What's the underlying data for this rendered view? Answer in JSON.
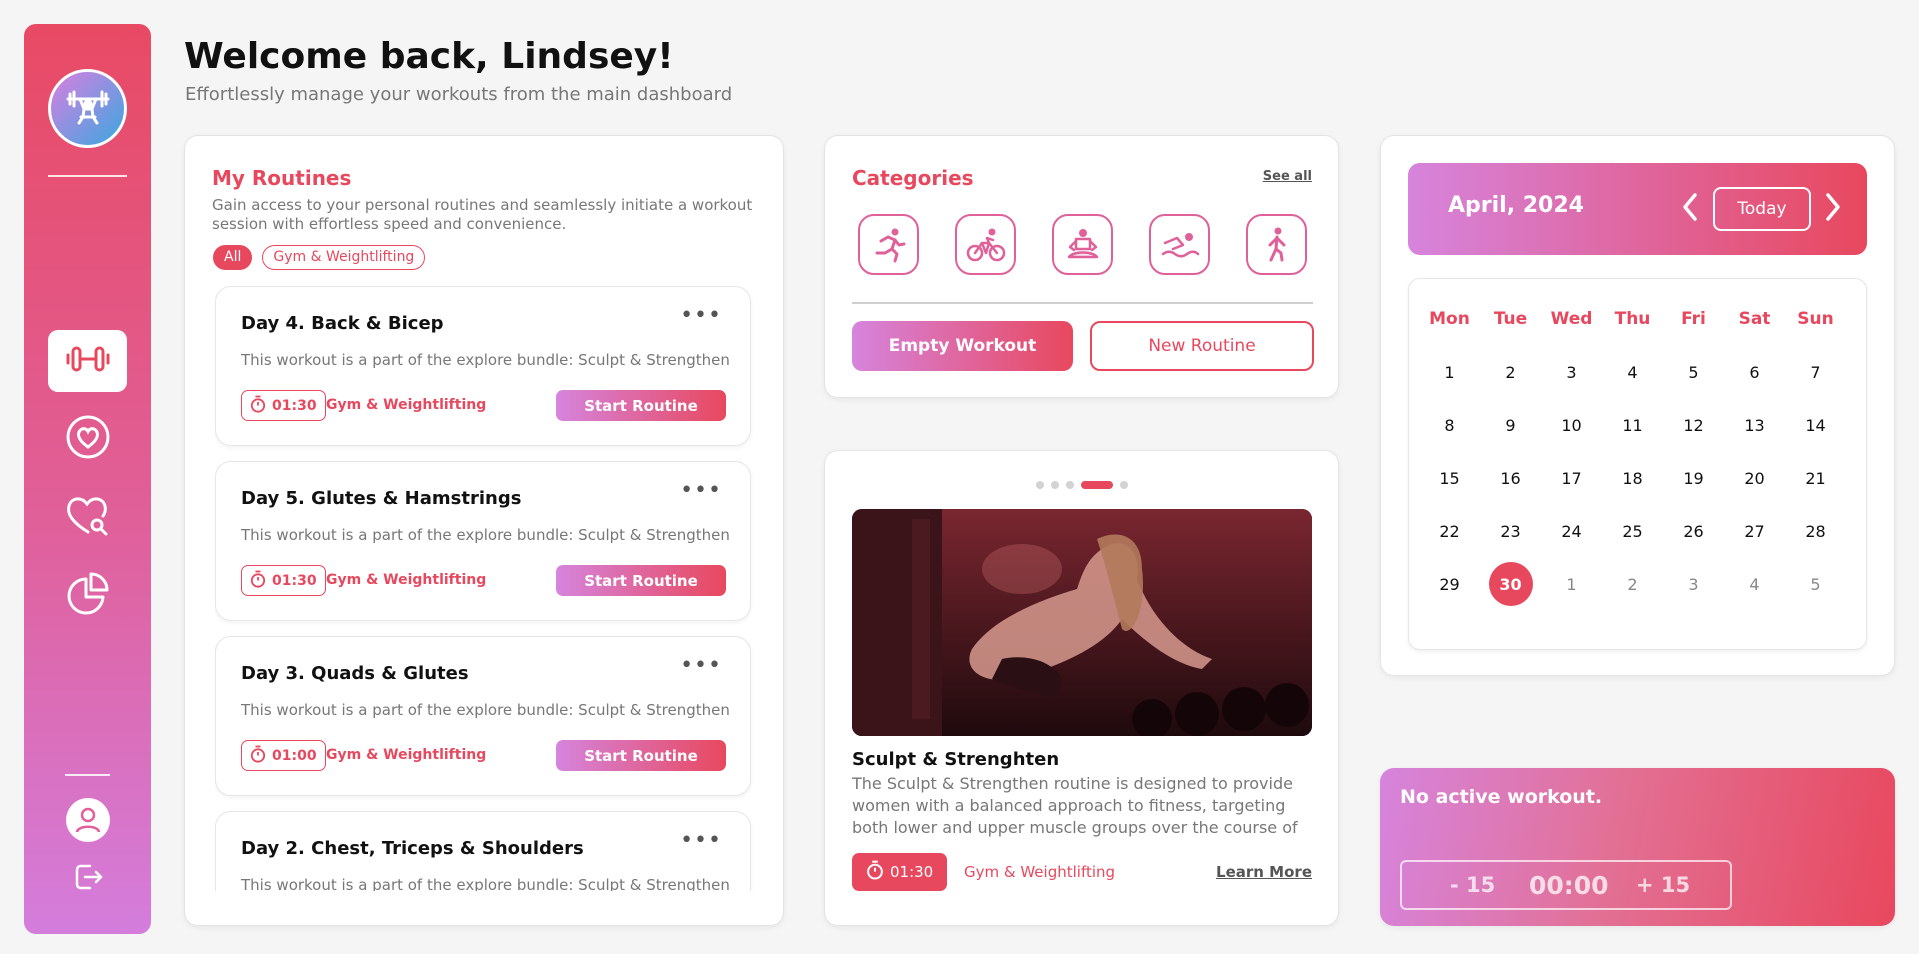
{
  "header": {
    "title": "Welcome back, Lindsey!",
    "subtitle": "Effortlessly manage your workouts from the main dashboard"
  },
  "sidebar": {
    "logo_icon": "weightlifter-icon",
    "nav": [
      {
        "icon": "dumbbell-icon",
        "active": true
      },
      {
        "icon": "heart-circle-icon",
        "active": false
      },
      {
        "icon": "heart-search-icon",
        "active": false
      },
      {
        "icon": "pie-chart-icon",
        "active": false
      }
    ],
    "bottom": [
      {
        "icon": "user-icon"
      },
      {
        "icon": "logout-icon"
      }
    ]
  },
  "routines": {
    "title": "My Routines",
    "description": "Gain access to your personal routines and seamlessly initiate a workout session with effortless speed and convenience.",
    "filters": [
      "All",
      "Gym & Weightlifting"
    ],
    "items": [
      {
        "title": "Day 4. Back & Bicep",
        "description": "This workout is a part of the explore bundle: Sculpt & Strengthen",
        "time": "01:30",
        "category": "Gym & Weightlifting",
        "action": "Start Routine"
      },
      {
        "title": "Day 5. Glutes & Hamstrings",
        "description": "This workout is a part of the explore bundle: Sculpt & Strengthen",
        "time": "01:30",
        "category": "Gym & Weightlifting",
        "action": "Start Routine"
      },
      {
        "title": "Day 3. Quads & Glutes",
        "description": "This workout is a part of the explore bundle: Sculpt & Strengthen",
        "time": "01:00",
        "category": "Gym & Weightlifting",
        "action": "Start Routine"
      },
      {
        "title": "Day 2. Chest, Triceps & Shoulders",
        "description": "This workout is a part of the explore bundle: Sculpt & Strengthen",
        "time": "",
        "category": "",
        "action": ""
      }
    ]
  },
  "categories": {
    "title": "Categories",
    "see_all": "See all",
    "icons": [
      "running-icon",
      "cycling-icon",
      "meditation-icon",
      "swimming-icon",
      "walking-icon"
    ],
    "empty_workout": "Empty Workout",
    "new_routine": "New Routine"
  },
  "featured": {
    "title": "Sculpt & Strenghten",
    "description": "The Sculpt & Strengthen routine is designed to provide women with a balanced approach to fitness, targeting both lower and upper muscle groups over the course of five day...",
    "time": "01:30",
    "category": "Gym & Weightlifting",
    "learn_more": "Learn More",
    "slides": 5,
    "active_slide": 4
  },
  "calendar": {
    "month": "April, 2024",
    "today": "Today",
    "weekdays": [
      "Mon",
      "Tue",
      "Wed",
      "Thu",
      "Fri",
      "Sat",
      "Sun"
    ],
    "days": [
      {
        "d": "1"
      },
      {
        "d": "2"
      },
      {
        "d": "3"
      },
      {
        "d": "4"
      },
      {
        "d": "5"
      },
      {
        "d": "6"
      },
      {
        "d": "7"
      },
      {
        "d": "8"
      },
      {
        "d": "9"
      },
      {
        "d": "10"
      },
      {
        "d": "11"
      },
      {
        "d": "12"
      },
      {
        "d": "13"
      },
      {
        "d": "14"
      },
      {
        "d": "15"
      },
      {
        "d": "16"
      },
      {
        "d": "17"
      },
      {
        "d": "18"
      },
      {
        "d": "19"
      },
      {
        "d": "20"
      },
      {
        "d": "21"
      },
      {
        "d": "22"
      },
      {
        "d": "23"
      },
      {
        "d": "24"
      },
      {
        "d": "25"
      },
      {
        "d": "26"
      },
      {
        "d": "27"
      },
      {
        "d": "28"
      },
      {
        "d": "29"
      },
      {
        "d": "30",
        "today": true
      },
      {
        "d": "1",
        "other": true
      },
      {
        "d": "2",
        "other": true
      },
      {
        "d": "3",
        "other": true
      },
      {
        "d": "4",
        "other": true
      },
      {
        "d": "5",
        "other": true
      }
    ]
  },
  "active_workout": {
    "status": "No active workout.",
    "minus": "- 15",
    "time": "00:00",
    "plus": "+ 15"
  },
  "colors": {
    "accent": "#e8485e",
    "gradient_start": "#d684dd",
    "gradient_end": "#e8485e",
    "background": "#f5f5f5"
  }
}
